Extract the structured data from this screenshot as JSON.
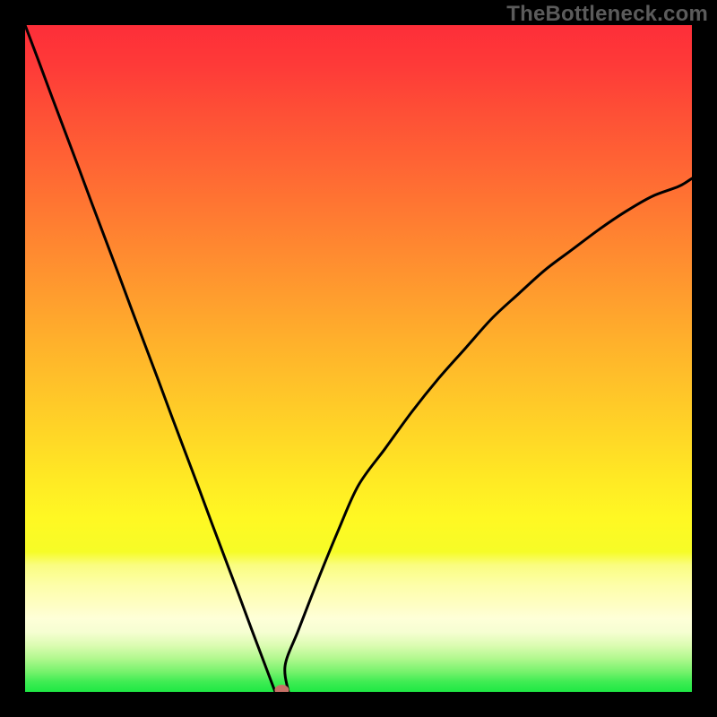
{
  "watermark": "TheBottleneck.com",
  "chart_data": {
    "type": "line",
    "title": "",
    "xlabel": "",
    "ylabel": "",
    "x": [
      0.0,
      0.02,
      0.04,
      0.06,
      0.08,
      0.1,
      0.12,
      0.14,
      0.16,
      0.18,
      0.2,
      0.22,
      0.24,
      0.26,
      0.28,
      0.3,
      0.32,
      0.34,
      0.36,
      0.375,
      0.39,
      0.41,
      0.44,
      0.47,
      0.5,
      0.54,
      0.58,
      0.62,
      0.66,
      0.7,
      0.74,
      0.78,
      0.82,
      0.86,
      0.9,
      0.94,
      0.98,
      1.0
    ],
    "values": [
      1.0,
      0.947,
      0.893,
      0.84,
      0.787,
      0.733,
      0.68,
      0.627,
      0.573,
      0.52,
      0.467,
      0.413,
      0.36,
      0.307,
      0.253,
      0.2,
      0.147,
      0.093,
      0.04,
      0.0,
      0.04,
      0.093,
      0.17,
      0.243,
      0.31,
      0.365,
      0.42,
      0.47,
      0.515,
      0.56,
      0.597,
      0.633,
      0.663,
      0.693,
      0.72,
      0.743,
      0.758,
      0.77
    ],
    "xlim": [
      0,
      1
    ],
    "ylim": [
      0,
      1
    ],
    "legend": false,
    "grid": false,
    "marker": {
      "x": 0.385,
      "y": 0.0
    },
    "background_gradient": {
      "stops": [
        {
          "pos": 0.0,
          "color": "#fd2e39"
        },
        {
          "pos": 0.06,
          "color": "#fe3a38"
        },
        {
          "pos": 0.13,
          "color": "#fe4f36"
        },
        {
          "pos": 0.2,
          "color": "#ff6234"
        },
        {
          "pos": 0.27,
          "color": "#ff7632"
        },
        {
          "pos": 0.34,
          "color": "#ff8a30"
        },
        {
          "pos": 0.41,
          "color": "#ff9e2e"
        },
        {
          "pos": 0.48,
          "color": "#ffb22b"
        },
        {
          "pos": 0.55,
          "color": "#ffc529"
        },
        {
          "pos": 0.62,
          "color": "#ffd826"
        },
        {
          "pos": 0.68,
          "color": "#ffe924"
        },
        {
          "pos": 0.74,
          "color": "#fff823"
        },
        {
          "pos": 0.79,
          "color": "#f6fc27"
        },
        {
          "pos": 0.81,
          "color": "#fafd81"
        },
        {
          "pos": 0.84,
          "color": "#fdfea9"
        },
        {
          "pos": 0.87,
          "color": "#fefec4"
        },
        {
          "pos": 0.89,
          "color": "#feffd8"
        },
        {
          "pos": 0.91,
          "color": "#f6fed2"
        },
        {
          "pos": 0.93,
          "color": "#dcfcb2"
        },
        {
          "pos": 0.95,
          "color": "#b1f88e"
        },
        {
          "pos": 0.97,
          "color": "#76f26c"
        },
        {
          "pos": 0.985,
          "color": "#3fec53"
        },
        {
          "pos": 1.0,
          "color": "#1ee844"
        }
      ]
    }
  }
}
